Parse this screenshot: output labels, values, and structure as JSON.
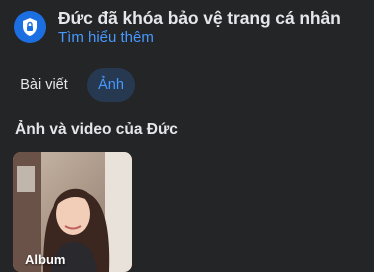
{
  "lock_banner": {
    "icon": "shield-lock-icon",
    "title": "Đức đã khóa bảo vệ trang cá nhân",
    "learn_more": "Tìm hiểu thêm",
    "accent_color": "#1b6fe0",
    "link_color": "#4599ff"
  },
  "tabs": [
    {
      "label": "Bài viết",
      "active": false
    },
    {
      "label": "Ảnh",
      "active": true
    }
  ],
  "section": {
    "title": "Ảnh và video của Đức"
  },
  "albums": [
    {
      "label": "Album"
    }
  ]
}
